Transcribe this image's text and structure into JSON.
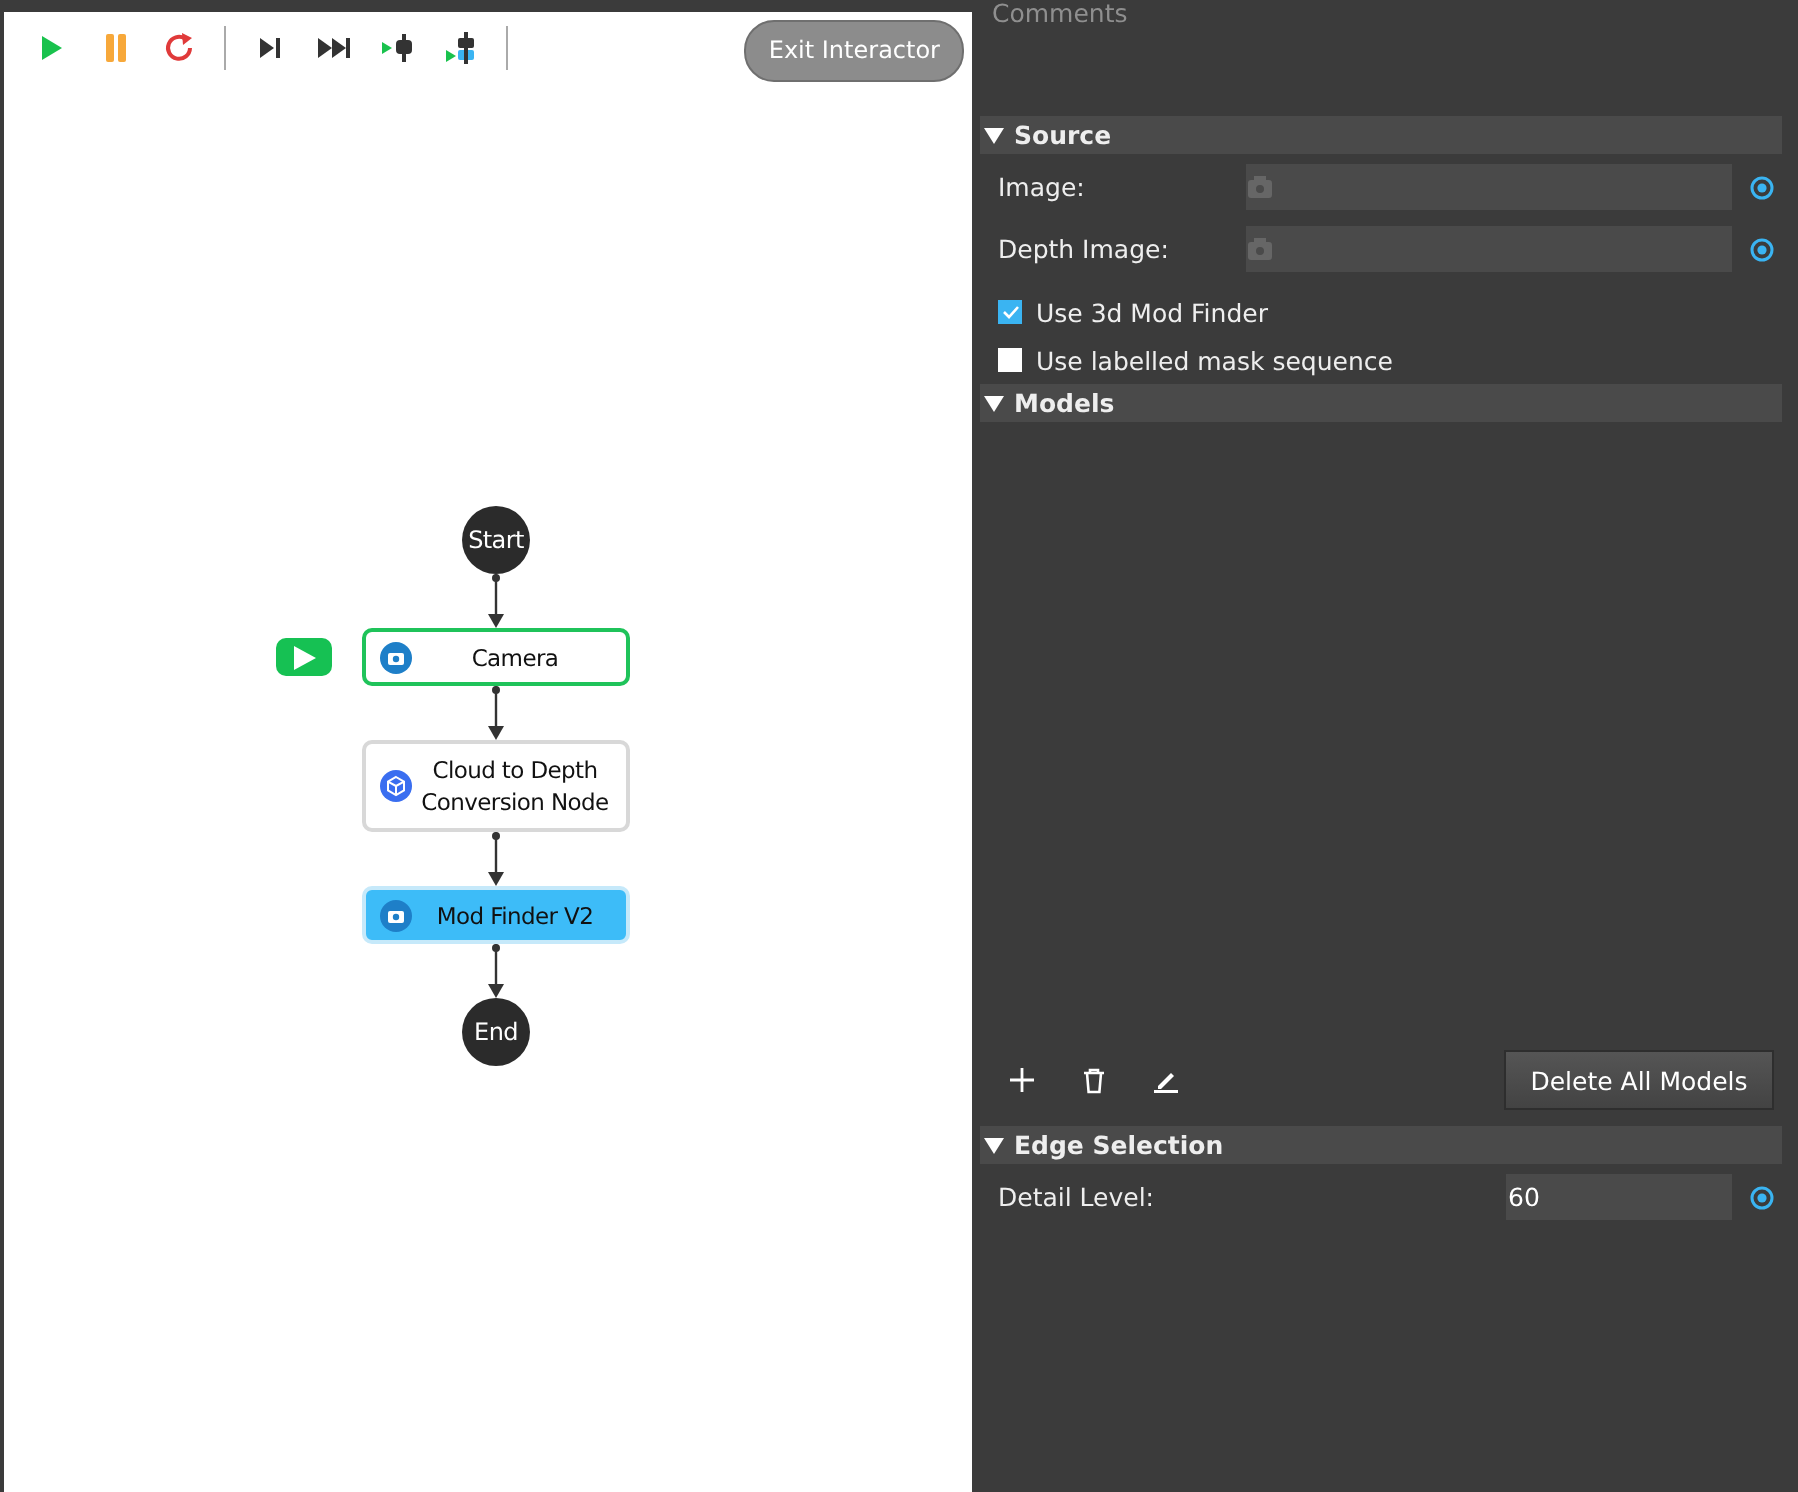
{
  "toolbar": {
    "buttons": [
      {
        "kind": "run"
      },
      {
        "kind": "pause"
      },
      {
        "kind": "reset"
      },
      {
        "kind": "divider"
      },
      {
        "kind": "step"
      },
      {
        "kind": "step-all"
      },
      {
        "kind": "run-to-node"
      },
      {
        "kind": "run-to-selected"
      },
      {
        "kind": "divider"
      }
    ],
    "exit_button": "Exit Interactor"
  },
  "diagram": {
    "nodes": [
      {
        "kind": "terminal",
        "label": "Start"
      },
      {
        "kind": "camera",
        "label": "Camera",
        "selected": false,
        "running": true
      },
      {
        "kind": "conversion",
        "label": "Cloud to Depth Conversion Node",
        "selected": false,
        "running": false
      },
      {
        "kind": "camera",
        "label": "Mod Finder V2",
        "selected": true,
        "running": false
      },
      {
        "kind": "terminal",
        "label": "End"
      }
    ]
  },
  "properties": {
    "comments_label": "Comments",
    "sections": [
      {
        "title": "Source",
        "expanded": true,
        "rows": [
          {
            "kind": "image-field",
            "label": "Image:"
          },
          {
            "kind": "image-field",
            "label": "Depth Image:"
          },
          {
            "kind": "checkbox",
            "label": "Use 3d Mod Finder",
            "checked": true
          },
          {
            "kind": "checkbox",
            "label": "Use labelled mask sequence",
            "checked": false
          }
        ]
      },
      {
        "title": "Models",
        "expanded": true,
        "rows": [
          {
            "kind": "model-list"
          },
          {
            "kind": "model-tools",
            "button": "Delete All Models"
          }
        ]
      },
      {
        "title": "Edge Selection",
        "expanded": true,
        "rows": [
          {
            "kind": "number-field",
            "label": "Detail Level:",
            "value": "60"
          }
        ]
      }
    ]
  }
}
